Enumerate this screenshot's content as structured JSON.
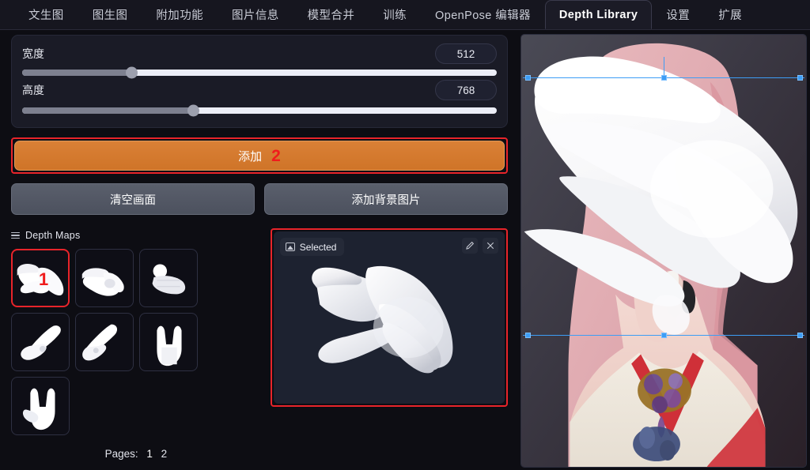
{
  "tabs": [
    {
      "label": "文生图",
      "active": false
    },
    {
      "label": "图生图",
      "active": false
    },
    {
      "label": "附加功能",
      "active": false
    },
    {
      "label": "图片信息",
      "active": false
    },
    {
      "label": "模型合并",
      "active": false
    },
    {
      "label": "训练",
      "active": false
    },
    {
      "label": "OpenPose 编辑器",
      "active": false
    },
    {
      "label": "Depth Library",
      "active": true
    },
    {
      "label": "设置",
      "active": false
    },
    {
      "label": "扩展",
      "active": false
    }
  ],
  "sliders": {
    "width": {
      "label": "宽度",
      "value": "512",
      "fill_percent": 23
    },
    "height": {
      "label": "高度",
      "value": "768",
      "fill_percent": 36
    }
  },
  "buttons": {
    "add": "添加",
    "add_annotation": "2",
    "clear_canvas": "清空画面",
    "add_background": "添加背景图片"
  },
  "depth_maps": {
    "title": "Depth Maps",
    "icon": "list-icon",
    "selected_index": 0,
    "selected_annotation": "1",
    "thumbnails": [
      {
        "name": "hand-pinch-side"
      },
      {
        "name": "hand-claw-down"
      },
      {
        "name": "hand-fist-front"
      },
      {
        "name": "hand-point-down"
      },
      {
        "name": "hand-point-diagonal"
      },
      {
        "name": "hand-horns-front"
      },
      {
        "name": "hand-horns-angled"
      }
    ],
    "pages_label": "Pages:",
    "pages": [
      "1",
      "2"
    ],
    "current_page": "1"
  },
  "selected_panel": {
    "chip_label": "Selected",
    "chip_icon": "image-icon",
    "edit_icon": "pencil-icon",
    "close_icon": "close-icon"
  },
  "colors": {
    "accent_orange": "#d4792e",
    "annotation_red": "#f01c1c",
    "selection_blue": "#3d9df5",
    "panel_bg": "#1d2230"
  }
}
